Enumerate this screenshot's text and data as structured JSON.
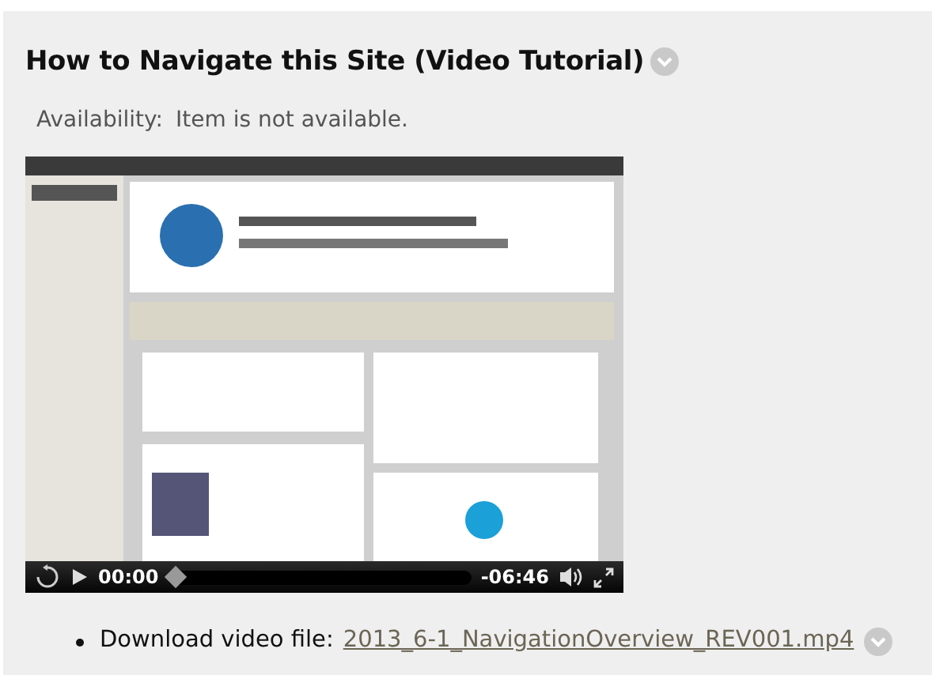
{
  "title": "How to Navigate this Site (Video Tutorial)",
  "availability": {
    "label": "Availability:",
    "value": "Item is not available."
  },
  "video": {
    "kind": "picture",
    "elapsed": "00:00",
    "remaining": "-06:46",
    "seek": {
      "level": 0
    }
  },
  "attachments": [
    {
      "label": "Download video file:",
      "link": "2013_6-1_NavigationOverview_REV001.mp4"
    }
  ]
}
